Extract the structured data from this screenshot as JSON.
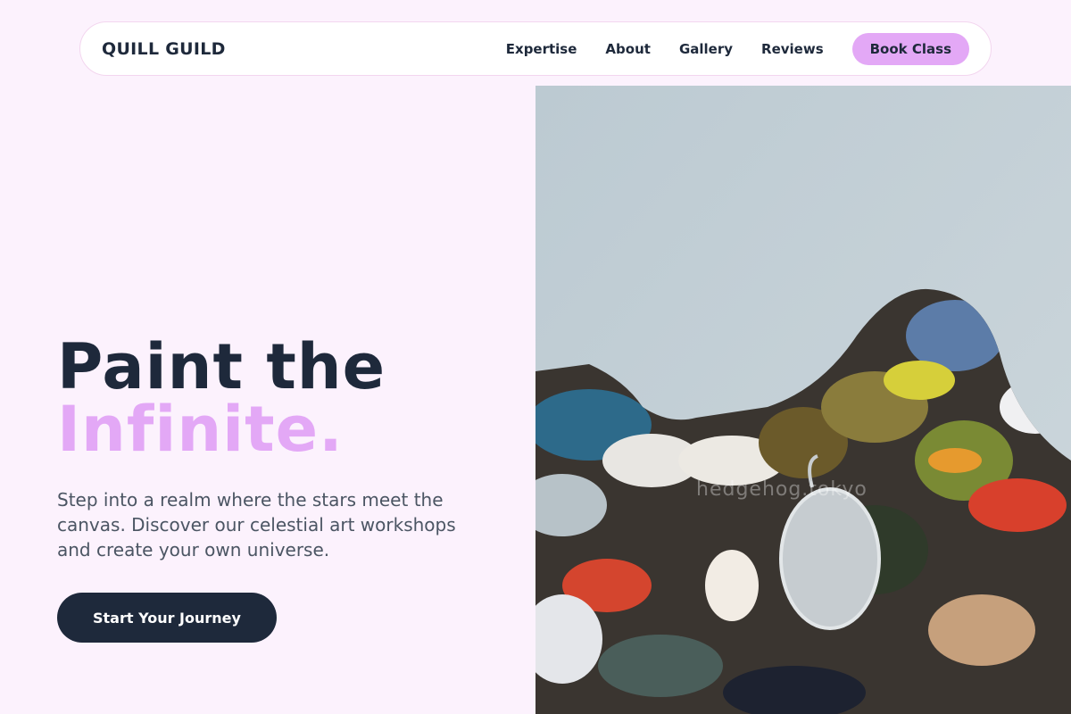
{
  "brand": {
    "name": "QUILL GUILD"
  },
  "nav": {
    "links": [
      "Expertise",
      "About",
      "Gallery",
      "Reviews"
    ],
    "cta_label": "Book Class"
  },
  "hero": {
    "headline_line1": "Paint the",
    "headline_line2": "Infinite.",
    "description": "Step into a realm where the stars meet the canvas. Discover our celestial art workshops and create your own universe.",
    "cta_label": "Start Your Journey"
  },
  "image": {
    "watermark": "hedgehog.tokyo"
  },
  "colors": {
    "background": "#fcf2fd",
    "accent": "#e3a8f6",
    "dark": "#1e293b",
    "body_text": "#4b5563"
  }
}
